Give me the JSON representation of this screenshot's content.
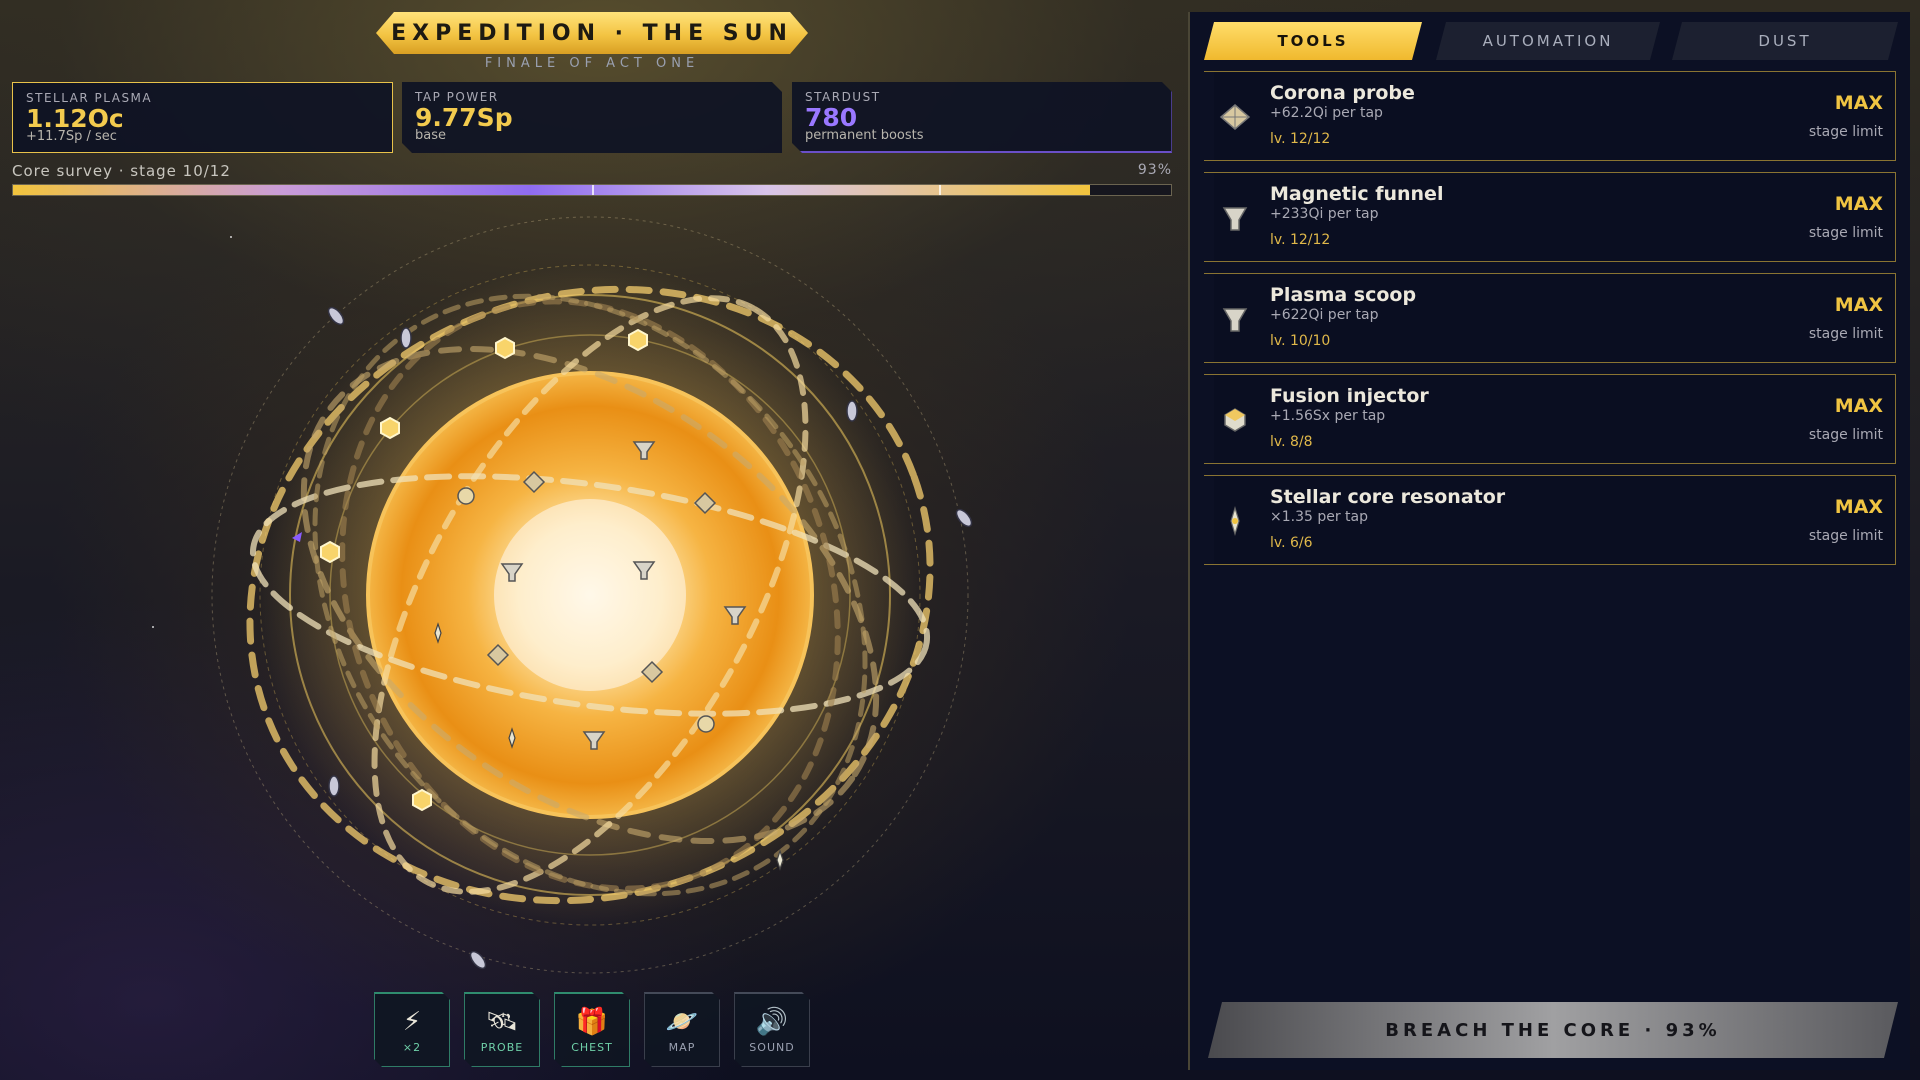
{
  "header": {
    "title": "EXPEDITION · THE SUN",
    "subtitle": "FINALE OF ACT ONE"
  },
  "stats": {
    "plasma": {
      "label": "STELLAR PLASMA",
      "value": "1.12Oc",
      "sub": "+11.7Sp / sec"
    },
    "tap": {
      "label": "TAP POWER",
      "value": "9.77Sp",
      "sub": "base"
    },
    "dust": {
      "label": "STARDUST",
      "value": "780",
      "sub": "permanent boosts"
    }
  },
  "survey": {
    "label": "Core survey · stage 10/12",
    "percent_text": "93%",
    "progress": 0.93,
    "milestones": [
      0.5,
      0.8
    ]
  },
  "bottom_buttons": [
    {
      "name": "boost-x2",
      "icon": "⚡",
      "label": "×2",
      "icon_name": "lightning-icon"
    },
    {
      "name": "probe",
      "icon": "🛰",
      "label": "PROBE",
      "icon_name": "satellite-icon"
    },
    {
      "name": "chest",
      "icon": "🎁",
      "label": "CHEST",
      "icon_name": "gift-icon"
    },
    {
      "name": "map",
      "icon": "🪐",
      "label": "MAP",
      "icon_name": "planet-icon"
    },
    {
      "name": "sound",
      "icon": "🔊",
      "label": "SOUND",
      "icon_name": "speaker-icon"
    }
  ],
  "tabs": [
    {
      "label": "TOOLS",
      "active": true
    },
    {
      "label": "AUTOMATION",
      "active": false
    },
    {
      "label": "DUST",
      "active": false
    }
  ],
  "tools": [
    {
      "name": "Corona probe",
      "rate": "+62.2Qi per tap",
      "level": "lv. 12/12",
      "max": "MAX",
      "limit": "stage limit",
      "icon": "kite-icon"
    },
    {
      "name": "Magnetic funnel",
      "rate": "+233Qi per tap",
      "level": "lv. 12/12",
      "max": "MAX",
      "limit": "stage limit",
      "icon": "funnel-icon"
    },
    {
      "name": "Plasma scoop",
      "rate": "+622Qi per tap",
      "level": "lv. 10/10",
      "max": "MAX",
      "limit": "stage limit",
      "icon": "scoop-icon"
    },
    {
      "name": "Fusion injector",
      "rate": "+1.56Sx per tap",
      "level": "lv. 8/8",
      "max": "MAX",
      "limit": "stage limit",
      "icon": "hexagon-icon"
    },
    {
      "name": "Stellar core resonator",
      "rate": "×1.35 per tap",
      "level": "lv. 6/6",
      "max": "MAX",
      "limit": "stage limit",
      "icon": "resonator-icon"
    }
  ],
  "breach_button": "BREACH THE CORE · 93%",
  "colors": {
    "gold": "#f3cb4e",
    "violet": "#9a78ff",
    "panel": "#0c1024",
    "teal": "#2f8c6e"
  }
}
